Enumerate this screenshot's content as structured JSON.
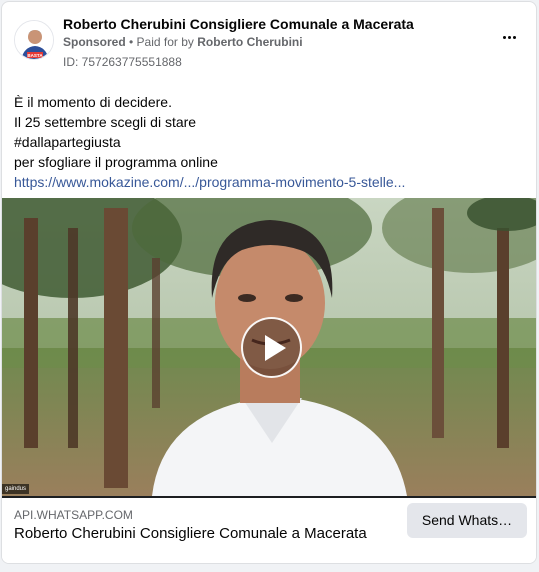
{
  "post": {
    "page_name": "Roberto Cherubini Consigliere Comunale a Macerata",
    "sponsored_label": "Sponsored",
    "separator": " • ",
    "paid_for_label": "Paid for by ",
    "payer": "Roberto Cherubini",
    "ad_id": "ID: 757263775551888",
    "avatar_text": "BASTA",
    "body_lines": [
      "È il momento di decidere.",
      "Il 25 settembre scegli di stare",
      "#dallapartegiusta",
      "per sfogliare il programma online"
    ],
    "link_text": "https://www.mokazine.com/.../programma-movimento-5-stelle..."
  },
  "media": {
    "corner_tag": "gaindus"
  },
  "footer": {
    "domain": "API.WHATSAPP.COM",
    "link_title": "Roberto Cherubini Consigliere Comunale a Macerata",
    "cta_label": "Send Whats…"
  },
  "colors": {
    "link": "#385898",
    "secondary_text": "#65676b",
    "cta_background": "#e4e6eb"
  },
  "icons": {
    "more": "more-horizontal-icon",
    "play": "play-icon"
  }
}
